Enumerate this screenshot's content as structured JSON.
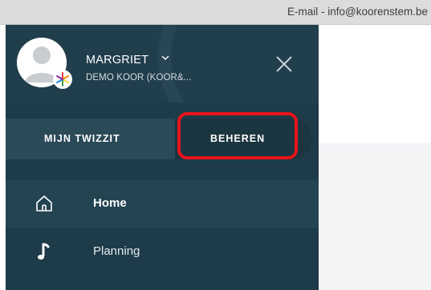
{
  "topbar": {
    "email_text": "E-mail - info@koorenstem.be"
  },
  "user": {
    "name": "MARGRIET",
    "organization": "DEMO KOOR (KOOR&..."
  },
  "tabs": [
    {
      "label": "MIJN TWIZZIT",
      "selected": false
    },
    {
      "label": "BEHEREN",
      "selected": true
    }
  ],
  "nav": {
    "items": [
      {
        "label": "Home",
        "icon": "home-icon",
        "active": true
      },
      {
        "label": "Planning",
        "icon": "music-note-icon",
        "active": false
      }
    ]
  },
  "colors": {
    "sidebar_bg": "#1d3b48",
    "highlight": "#e8141b",
    "topbar_bg": "#dcdcdc"
  }
}
